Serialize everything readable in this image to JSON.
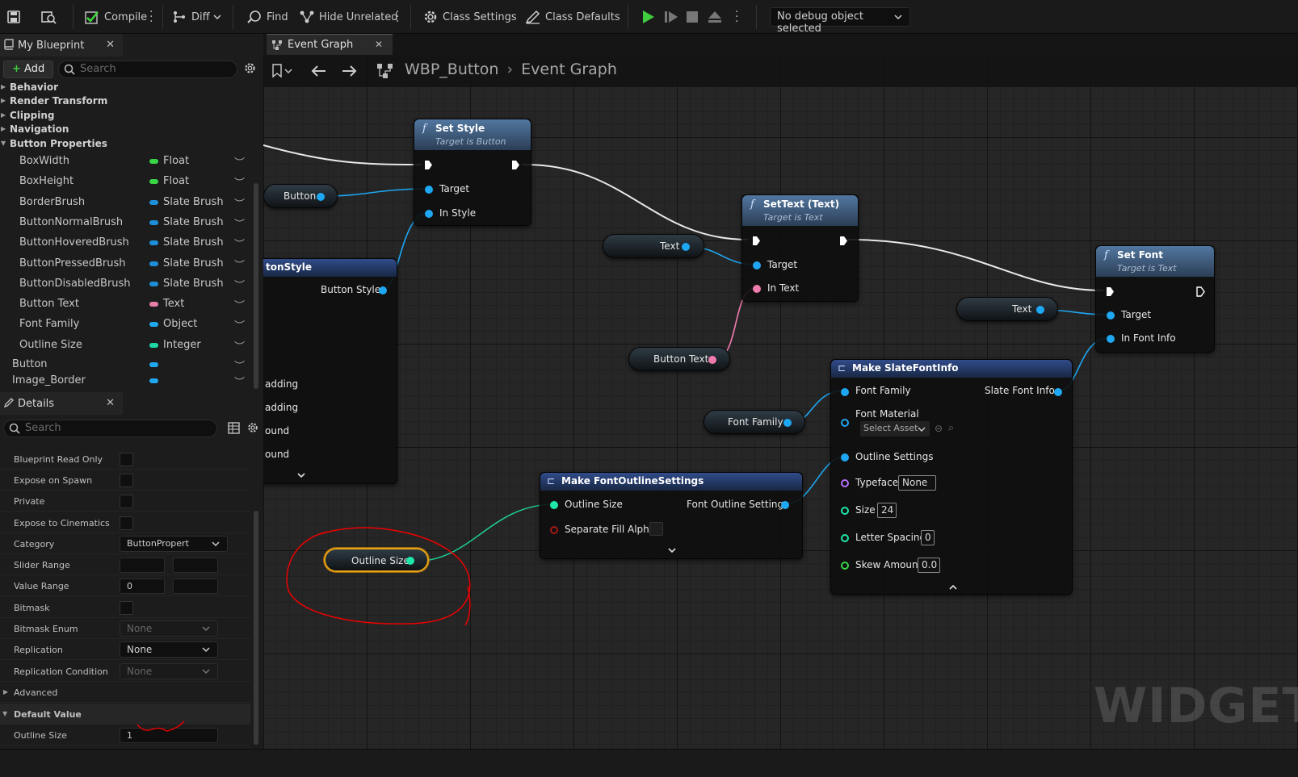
{
  "toolbar": {
    "compile": "Compile",
    "diff": "Diff",
    "find": "Find",
    "hide_unrelated": "Hide Unrelated",
    "class_settings": "Class Settings",
    "class_defaults": "Class Defaults",
    "debug_object": "No debug object selected"
  },
  "my_blueprint": {
    "tab": "My Blueprint",
    "add": "Add",
    "search_placeholder": "Search",
    "categories": [
      "Behavior",
      "Render Transform",
      "Clipping",
      "Navigation",
      "Button Properties"
    ],
    "variables": [
      {
        "name": "BoxWidth",
        "type": "Float",
        "color": "#38d545"
      },
      {
        "name": "BoxHeight",
        "type": "Float",
        "color": "#38d545"
      },
      {
        "name": "BorderBrush",
        "type": "Slate Brush",
        "color": "#1f8ed8"
      },
      {
        "name": "ButtonNormalBrush",
        "type": "Slate Brush",
        "color": "#1f8ed8"
      },
      {
        "name": "ButtonHoveredBrush",
        "type": "Slate Brush",
        "color": "#1f8ed8"
      },
      {
        "name": "ButtonPressedBrush",
        "type": "Slate Brush",
        "color": "#1f8ed8"
      },
      {
        "name": "ButtonDisabledBrush",
        "type": "Slate Brush",
        "color": "#1f8ed8"
      },
      {
        "name": "Button Text",
        "type": "Text",
        "color": "#e87fa8"
      },
      {
        "name": "Font Family",
        "type": "Object",
        "color": "#1fa8f0"
      },
      {
        "name": "Outline Size",
        "type": "Integer",
        "color": "#1fd8a8"
      }
    ],
    "widgets": [
      {
        "name": "Button",
        "color": "#1fa8f0"
      },
      {
        "name": "Image_Border",
        "color": "#1fa8f0"
      }
    ]
  },
  "details": {
    "tab": "Details",
    "search_placeholder": "Search",
    "blueprint_read_only": "Blueprint Read Only",
    "expose_on_spawn": "Expose on Spawn",
    "private": "Private",
    "expose_to_cinematics": "Expose to Cinematics",
    "category_label": "Category",
    "category_value": "ButtonPropert",
    "slider_range": "Slider Range",
    "value_range": "Value Range",
    "value_range_min": "0",
    "bitmask": "Bitmask",
    "bitmask_enum": "Bitmask Enum",
    "bitmask_enum_value": "None",
    "replication": "Replication",
    "replication_value": "None",
    "replication_condition": "Replication Condition",
    "replication_condition_value": "None",
    "advanced": "Advanced",
    "default_value": "Default Value",
    "outline_size_label": "Outline Size",
    "outline_size_value": "1"
  },
  "graph": {
    "tab": "Event Graph",
    "breadcrumb_root": "WBP_Button",
    "breadcrumb_leaf": "Event Graph",
    "watermark": "WIDGET",
    "set_style": {
      "title": "Set Style",
      "subtitle": "Target is Button",
      "target": "Target",
      "in_style": "In Style"
    },
    "button_getter": "Button",
    "button_style_node": {
      "title": "tonStyle",
      "out": "Button Style",
      "rows": [
        "adding",
        "adding",
        "ound",
        "ound"
      ]
    },
    "settext": {
      "title": "SetText (Text)",
      "subtitle": "Target is Text",
      "target": "Target",
      "in_text": "In Text"
    },
    "text_getter_1": "Text",
    "button_text_getter": "Button Text",
    "set_font": {
      "title": "Set Font",
      "subtitle": "Target is Text",
      "target": "Target",
      "in_font_info": "In Font Info"
    },
    "text_getter_2": "Text",
    "make_slate_font_info": {
      "title": "Make SlateFontInfo",
      "font_family": "Font Family",
      "out": "Slate Font Info",
      "font_material": "Font Material",
      "select_asset": "Select Asset",
      "outline_settings": "Outline Settings",
      "typeface": "Typeface",
      "typeface_value": "None",
      "size": "Size",
      "size_value": "24",
      "letter_spacing": "Letter Spacing",
      "letter_spacing_value": "0",
      "skew_amount": "Skew Amount",
      "skew_amount_value": "0.0"
    },
    "font_family_getter": "Font Family",
    "make_font_outline": {
      "title": "Make FontOutlineSettings",
      "outline_size": "Outline Size",
      "out": "Font Outline Settings",
      "separate_fill_alpha": "Separate Fill Alpha"
    },
    "outline_size_getter": "Outline Size"
  }
}
